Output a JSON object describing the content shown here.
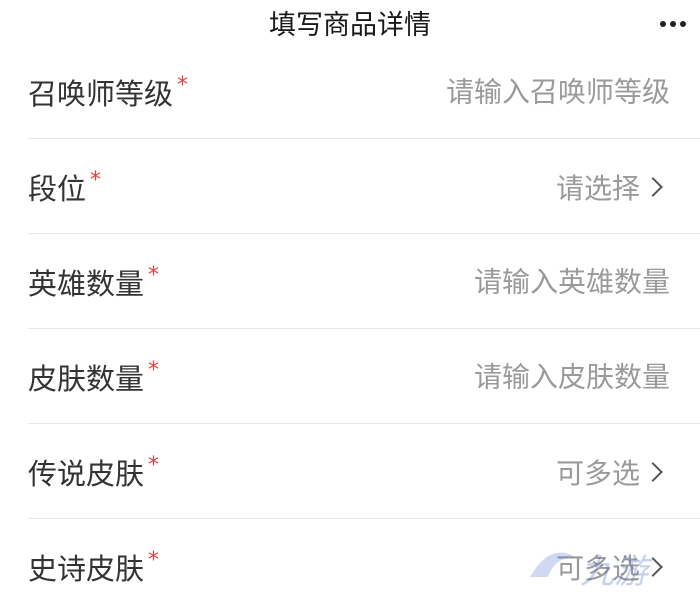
{
  "header": {
    "title": "填写商品详情",
    "more_icon": "more-dots-icon"
  },
  "required_mark": "*",
  "form": {
    "rows": [
      {
        "label": "召唤师等级",
        "type": "input",
        "placeholder": "请输入召唤师等级"
      },
      {
        "label": "段位",
        "type": "select",
        "value": "请选择"
      },
      {
        "label": "英雄数量",
        "type": "input",
        "placeholder": "请输入英雄数量"
      },
      {
        "label": "皮肤数量",
        "type": "input",
        "placeholder": "请输入皮肤数量"
      },
      {
        "label": "传说皮肤",
        "type": "select",
        "value": "可多选"
      },
      {
        "label": "史诗皮肤",
        "type": "select",
        "value": "可多选"
      }
    ]
  },
  "watermark": {
    "text": "九游"
  },
  "colors": {
    "required": "#e64340",
    "placeholder": "#9a9a9a",
    "label": "#333333",
    "divider": "#e6e6e6"
  }
}
